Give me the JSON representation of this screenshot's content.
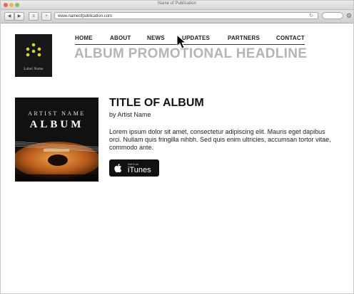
{
  "browser": {
    "window_title": "Name of Publication",
    "url": "www.nameofpublication.com"
  },
  "site": {
    "logo_text": "Label Name",
    "nav": [
      {
        "label": "HOME"
      },
      {
        "label": "ABOUT"
      },
      {
        "label": "NEWS"
      },
      {
        "label": "UPDATES"
      },
      {
        "label": "PARTNERS"
      },
      {
        "label": "CONTACT"
      }
    ],
    "headline": "ALBUM PROMOTIONAL HEADLINE",
    "album": {
      "art_artist": "ARTIST NAME",
      "art_album": "ALBUM",
      "title": "TITLE OF ALBUM",
      "artist_line": "by Artist Name",
      "description": "Lorem ipsum dolor sit amet, consectetur adipiscing elit. Mauris eget dapibus orci. Nullam quis fringilla nihbh. Sed quis enim ultricies, accumsan tortor vitae, commodo ante."
    },
    "itunes": {
      "small_label": "Get it on",
      "label": "iTunes"
    }
  },
  "colors": {
    "headline": "#b5b5b5",
    "logo_dots": "#d8d33a"
  }
}
